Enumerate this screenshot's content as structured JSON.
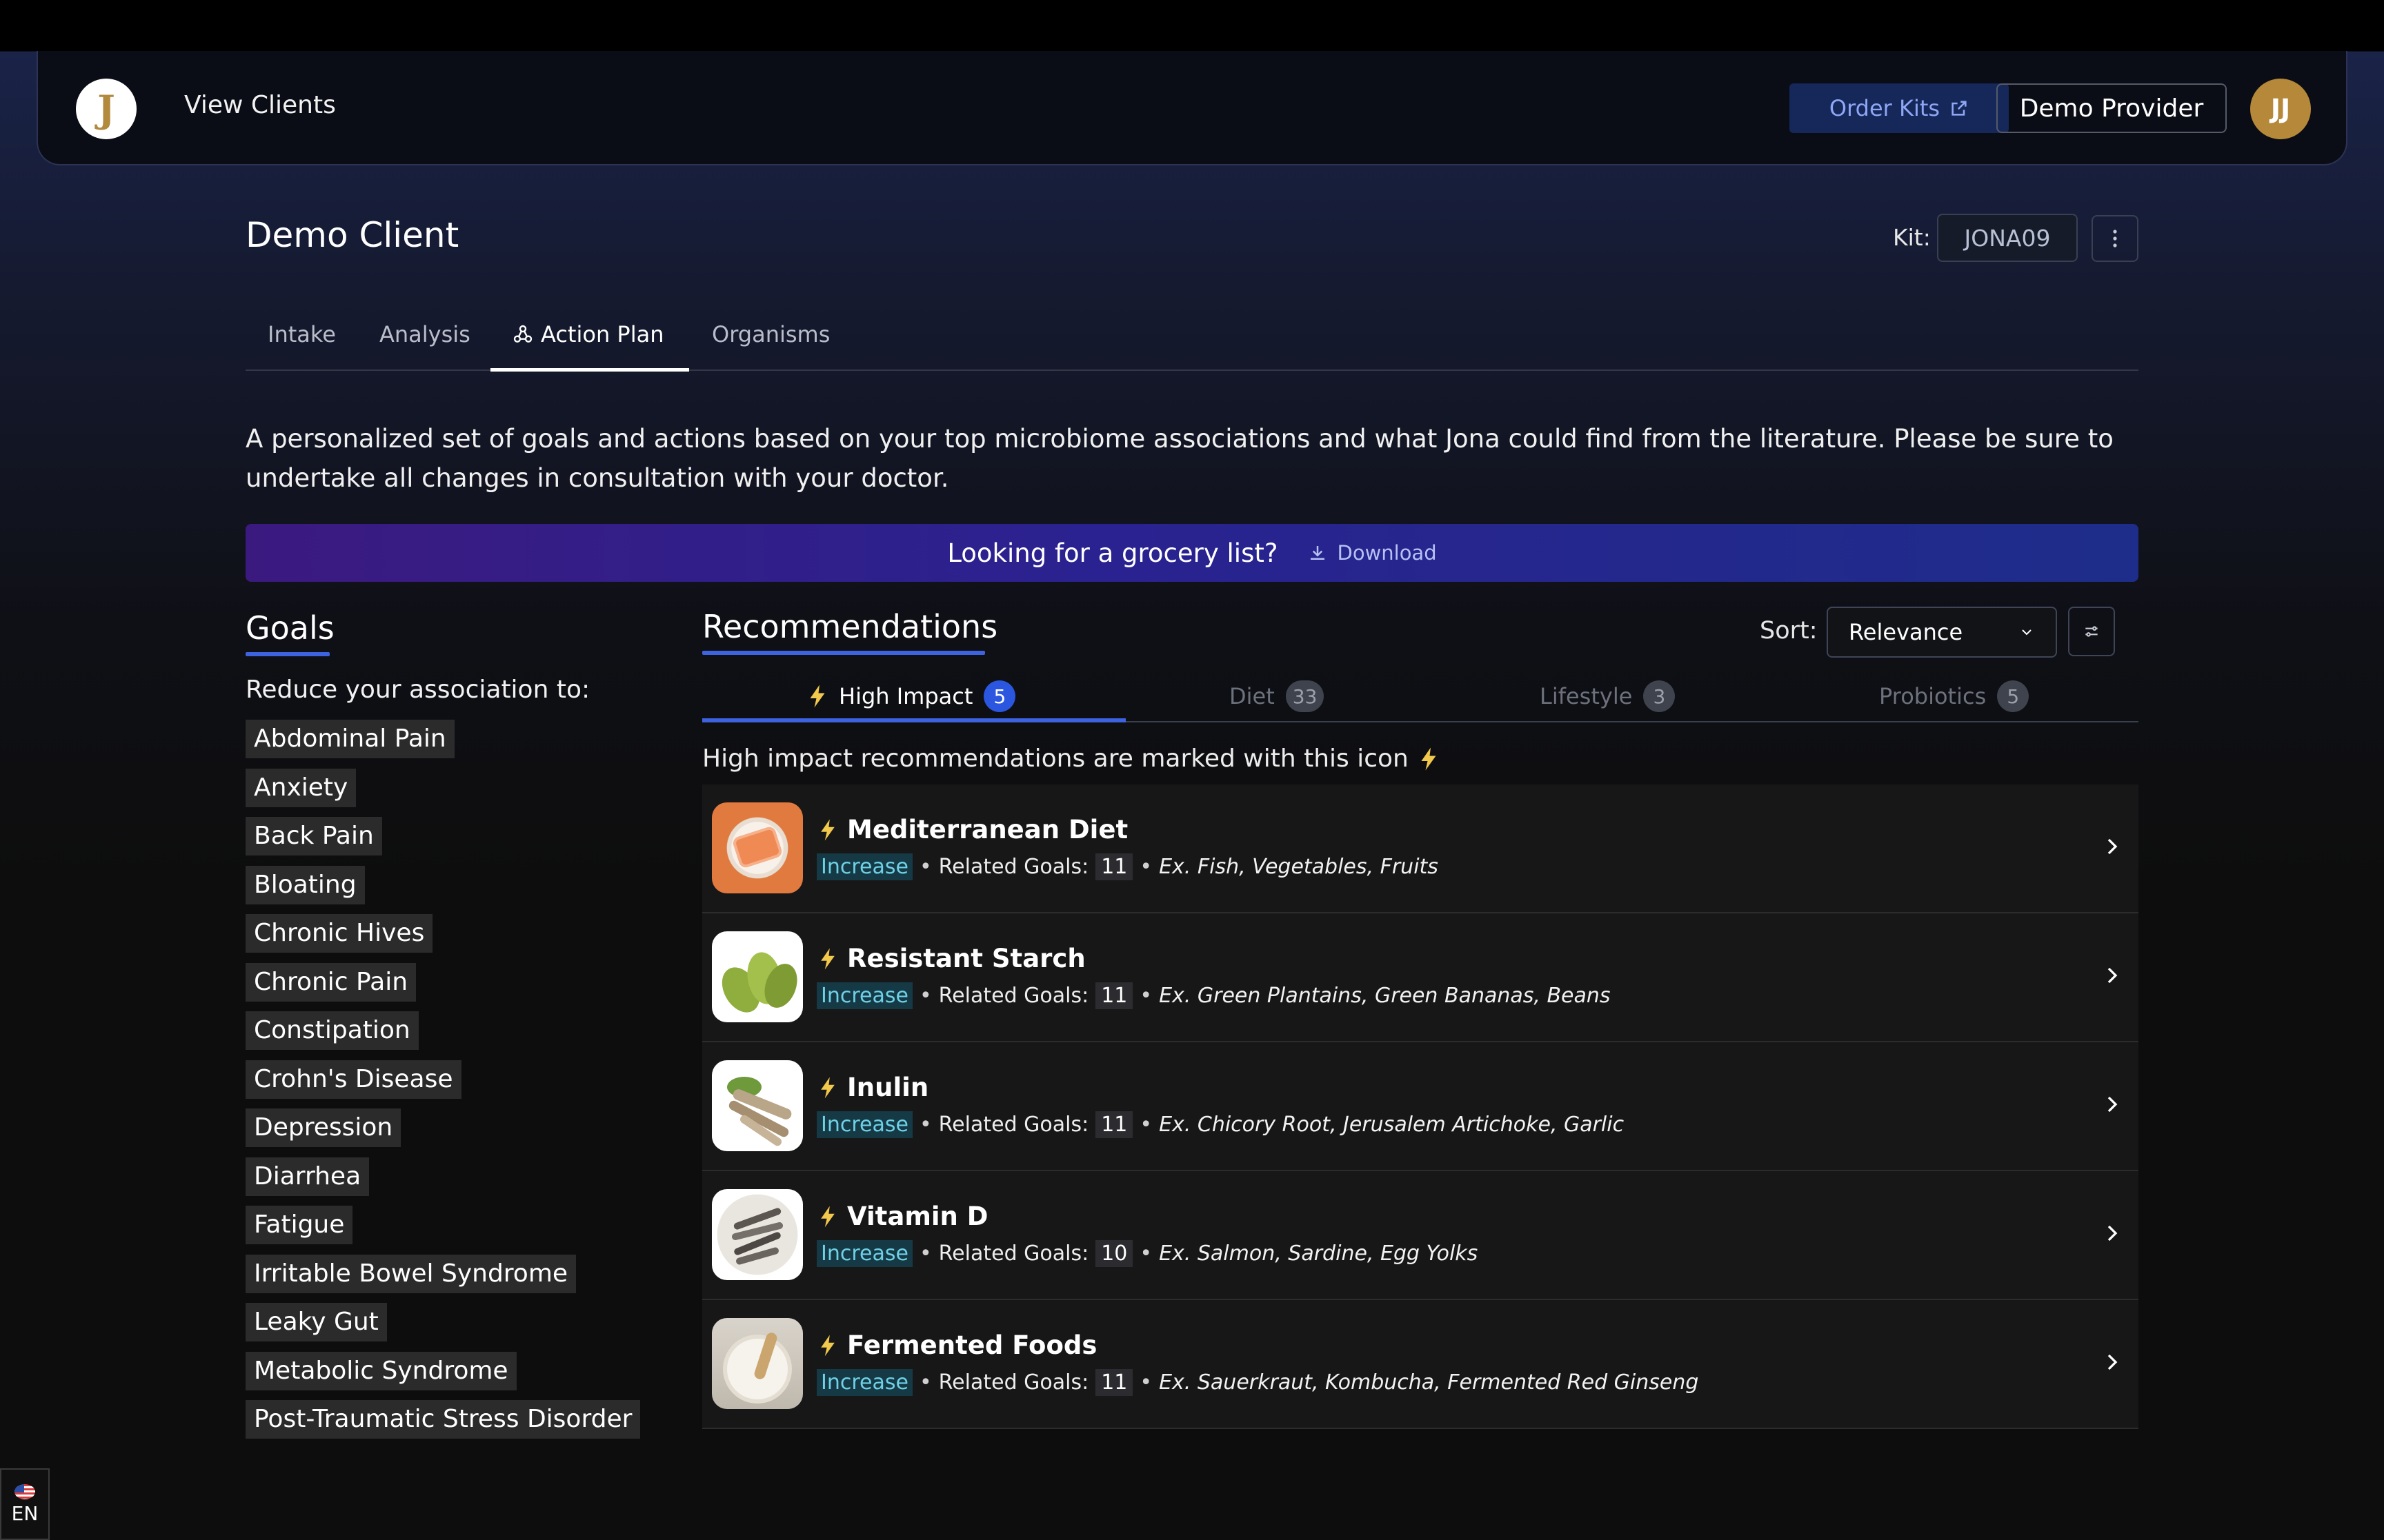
{
  "header": {
    "logo_letter": "J",
    "nav_link": "View Clients",
    "order_kits": "Order Kits",
    "provider": "Demo Provider",
    "avatar_initials": "JJ"
  },
  "client": {
    "name": "Demo Client",
    "kit_label": "Kit:",
    "kit_code": "JONA09"
  },
  "tabs": [
    {
      "label": "Intake"
    },
    {
      "label": "Analysis"
    },
    {
      "label": "Action Plan",
      "active": true
    },
    {
      "label": "Organisms"
    }
  ],
  "intro": "A personalized set of goals and actions based on your top microbiome associations and what Jona could find from the literature. Please be sure to undertake all changes in consultation with your doctor.",
  "grocery": {
    "question": "Looking for a grocery list?",
    "download": "Download"
  },
  "goals": {
    "title": "Goals",
    "subtitle": "Reduce your association to:",
    "items": [
      "Abdominal Pain",
      "Anxiety",
      "Back Pain",
      "Bloating",
      "Chronic Hives",
      "Chronic Pain",
      "Constipation",
      "Crohn's Disease",
      "Depression",
      "Diarrhea",
      "Fatigue",
      "Irritable Bowel Syndrome",
      "Leaky Gut",
      "Metabolic Syndrome",
      "Post-Traumatic Stress Disorder"
    ]
  },
  "recommendations": {
    "title": "Recommendations",
    "sort_label": "Sort:",
    "sort_value": "Relevance",
    "tabs": [
      {
        "label": "High Impact",
        "count": "5",
        "active": true
      },
      {
        "label": "Diet",
        "count": "33"
      },
      {
        "label": "Lifestyle",
        "count": "3"
      },
      {
        "label": "Probiotics",
        "count": "5"
      }
    ],
    "hint": "High impact recommendations are marked with this icon",
    "related_label": "Related Goals:",
    "items": [
      {
        "name": "Mediterranean Diet",
        "direction": "Increase",
        "related": "11",
        "examples": "Ex. Fish, Vegetables, Fruits"
      },
      {
        "name": "Resistant Starch",
        "direction": "Increase",
        "related": "11",
        "examples": "Ex. Green Plantains, Green Bananas, Beans"
      },
      {
        "name": "Inulin",
        "direction": "Increase",
        "related": "11",
        "examples": "Ex. Chicory Root, Jerusalem Artichoke, Garlic"
      },
      {
        "name": "Vitamin D",
        "direction": "Increase",
        "related": "10",
        "examples": "Ex. Salmon, Sardine, Egg Yolks"
      },
      {
        "name": "Fermented Foods",
        "direction": "Increase",
        "related": "11",
        "examples": "Ex. Sauerkraut, Kombucha, Fermented Red Ginseng"
      }
    ]
  },
  "language": "EN",
  "colors": {
    "accent": "#3d63e0",
    "avatar": "#b6883a",
    "bolt": "#f2c94c"
  }
}
